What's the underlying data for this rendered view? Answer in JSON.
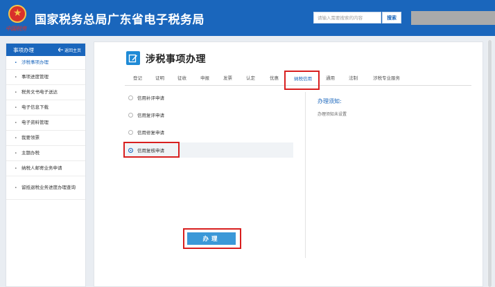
{
  "header": {
    "title": "国家税务总局广东省电子税务局",
    "emblem_text": "中国税务",
    "search_placeholder": "请输入需要搜索的内容",
    "search_button": "搜索",
    "brand_color": "#1a66bc"
  },
  "sidebar": {
    "title": "事项办理",
    "back_label": "返回主页",
    "items": [
      {
        "label": "涉税事项办理",
        "active": true
      },
      {
        "label": "事项进度管理"
      },
      {
        "label": "税务文书电子送达"
      },
      {
        "label": "电子信息下载"
      },
      {
        "label": "电子资料管理"
      },
      {
        "label": "我要领票"
      },
      {
        "label": "主题办税"
      },
      {
        "label": "纳税人邮寄业务申请"
      },
      {
        "label": "留抵退税业务进度办理查询"
      }
    ]
  },
  "main": {
    "page_title": "涉税事项办理",
    "tabs": [
      {
        "label": "登记"
      },
      {
        "label": "证明"
      },
      {
        "label": "征收"
      },
      {
        "label": "申报"
      },
      {
        "label": "发票"
      },
      {
        "label": "认定"
      },
      {
        "label": "优惠"
      },
      {
        "label": "纳税信用",
        "active": true
      },
      {
        "label": "通用"
      },
      {
        "label": "法制"
      },
      {
        "label": "涉税专业服务"
      }
    ],
    "options": [
      {
        "label": "信用补评申请"
      },
      {
        "label": "信用复评申请"
      },
      {
        "label": "信用修复申请"
      },
      {
        "label": "信用复核申请",
        "selected": true
      }
    ],
    "notice_title": "办理须知:",
    "notice_body": "办理须知未设置",
    "submit_button": "办理"
  }
}
